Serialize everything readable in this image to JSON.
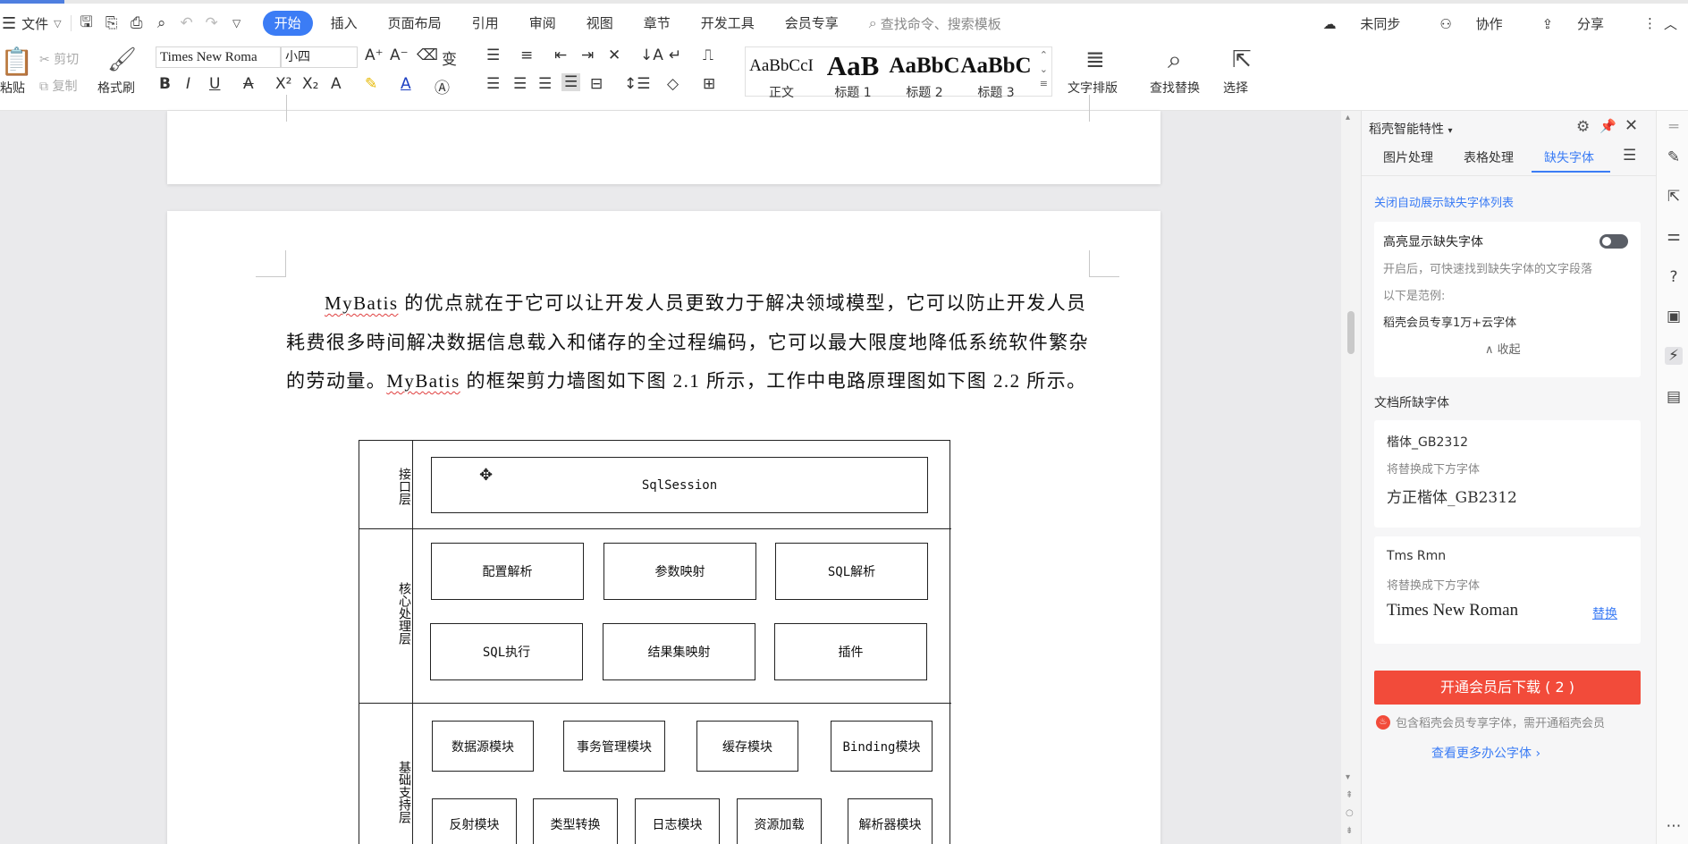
{
  "menu": {
    "file": "文件",
    "tabs": [
      "开始",
      "插入",
      "页面布局",
      "引用",
      "审阅",
      "视图",
      "章节",
      "开发工具",
      "会员专享"
    ],
    "search_placeholder": "查找命令、搜索模板",
    "sync": "未同步",
    "collab": "协作",
    "share": "分享"
  },
  "ribbon": {
    "paste": "粘贴",
    "cut": "剪切",
    "copy": "复制",
    "format_painter": "格式刷",
    "font_name": "Times New Roma",
    "font_size": "小四",
    "styles": [
      {
        "preview": "AaBbCcI",
        "label": "正文"
      },
      {
        "preview": "AaB",
        "label": "标题 1"
      },
      {
        "preview": "AaBbC",
        "label": "标题 2"
      },
      {
        "preview": "AaBbC",
        "label": "标题 3"
      }
    ],
    "text_layout": "文字排版",
    "find_replace": "查找替换",
    "select": "选择"
  },
  "document": {
    "para_p1a": "MyBatis",
    "para_p1b": " 的优点就在于它可以让开发人员更致力于解决领域模型，它可以防止开发人员耗费很多時间解决数据信息载入和储存的全过程编码，它可以最大限度地降低系统软件繁杂的劳动量。",
    "para_p2a": "MyBatis",
    "para_p2b": " 的框架剪力墙图如下图 2.1 所示，工作中电路原理图如下图 2.2 所示。",
    "diagram": {
      "layer_interface": "接口层",
      "layer_core": "核心处理层",
      "layer_base": "基础支持层",
      "sqlsession": "SqlSession",
      "core": [
        "配置解析",
        "参数映射",
        "SQL解析",
        "SQL执行",
        "结果集映射",
        "插件"
      ],
      "base_row1": [
        "数据源模块",
        "事务管理模块",
        "缓存模块",
        "Binding模块"
      ],
      "base_row2": [
        "反射模块",
        "类型转换",
        "日志模块",
        "资源加载",
        "解析器模块"
      ]
    }
  },
  "panel": {
    "title": "稻壳智能特性",
    "tabs": [
      "图片处理",
      "表格处理",
      "缺失字体"
    ],
    "close_auto": "关闭自动展示缺失字体列表",
    "highlight_title": "高亮显示缺失字体",
    "highlight_desc": "开启后，可快速找到缺失字体的文字段落",
    "example_label": "以下是范例:",
    "example_text": "稻壳会员专享1万+云字体",
    "collapse": "收起",
    "missing_title": "文档所缺字体",
    "font1_name": "楷体_GB2312",
    "replace_hint1": "将替换成下方字体",
    "font1_repl": "方正楷体_GB2312",
    "font2_name": "Tms Rmn",
    "replace_hint2": "将替换成下方字体",
    "font2_repl": "Times New Roman",
    "replace_link": "替换",
    "download_btn": "开通会员后下载 ( 2 )",
    "member_note": "包含稻壳会员专享字体，需开通稻壳会员",
    "more_fonts": "查看更多办公字体 ›"
  },
  "colors": {
    "accent": "#3b7cf5",
    "download": "#f24b3a",
    "link": "#3b7cf5"
  }
}
